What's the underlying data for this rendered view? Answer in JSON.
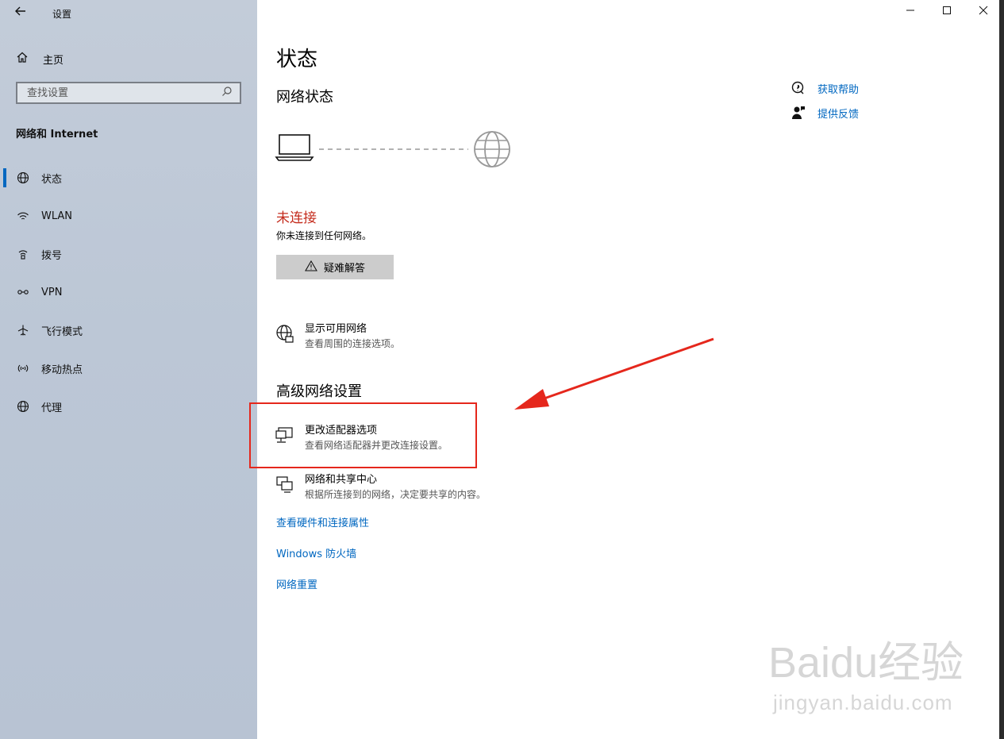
{
  "window": {
    "title": "设置",
    "controls": {
      "minimize": "—",
      "maximize": "☐",
      "close": "✕"
    }
  },
  "sidebar": {
    "home_label": "主页",
    "search_placeholder": "查找设置",
    "section_title": "网络和 Internet",
    "items": [
      {
        "label": "状态",
        "icon": "status-globe-icon",
        "active": true
      },
      {
        "label": "WLAN",
        "icon": "wlan-icon",
        "active": false
      },
      {
        "label": "拨号",
        "icon": "dialup-icon",
        "active": false
      },
      {
        "label": "VPN",
        "icon": "vpn-icon",
        "active": false
      },
      {
        "label": "飞行模式",
        "icon": "airplane-icon",
        "active": false
      },
      {
        "label": "移动热点",
        "icon": "hotspot-icon",
        "active": false
      },
      {
        "label": "代理",
        "icon": "proxy-globe-icon",
        "active": false
      }
    ]
  },
  "main": {
    "title": "状态",
    "network_status_title": "网络状态",
    "status_text": "未连接",
    "status_desc": "你未连接到任何网络。",
    "troubleshoot_label": "疑难解答",
    "show_networks": {
      "title": "显示可用网络",
      "desc": "查看周围的连接选项。"
    },
    "advanced_title": "高级网络设置",
    "adapter_options": {
      "title": "更改适配器选项",
      "desc": "查看网络适配器并更改连接设置。"
    },
    "sharing_center": {
      "title": "网络和共享中心",
      "desc": "根据所连接到的网络，决定要共享的内容。"
    },
    "links": {
      "hardware": "查看硬件和连接属性",
      "firewall": "Windows 防火墙",
      "reset": "网络重置"
    }
  },
  "help": {
    "get_help": "获取帮助",
    "feedback": "提供反馈"
  },
  "colors": {
    "accent": "#0067c0",
    "status_red": "#c42b1c",
    "annotation_red": "#e5271c"
  },
  "watermark": {
    "brand": "Baidu经验",
    "url": "jingyan.baidu.com"
  }
}
